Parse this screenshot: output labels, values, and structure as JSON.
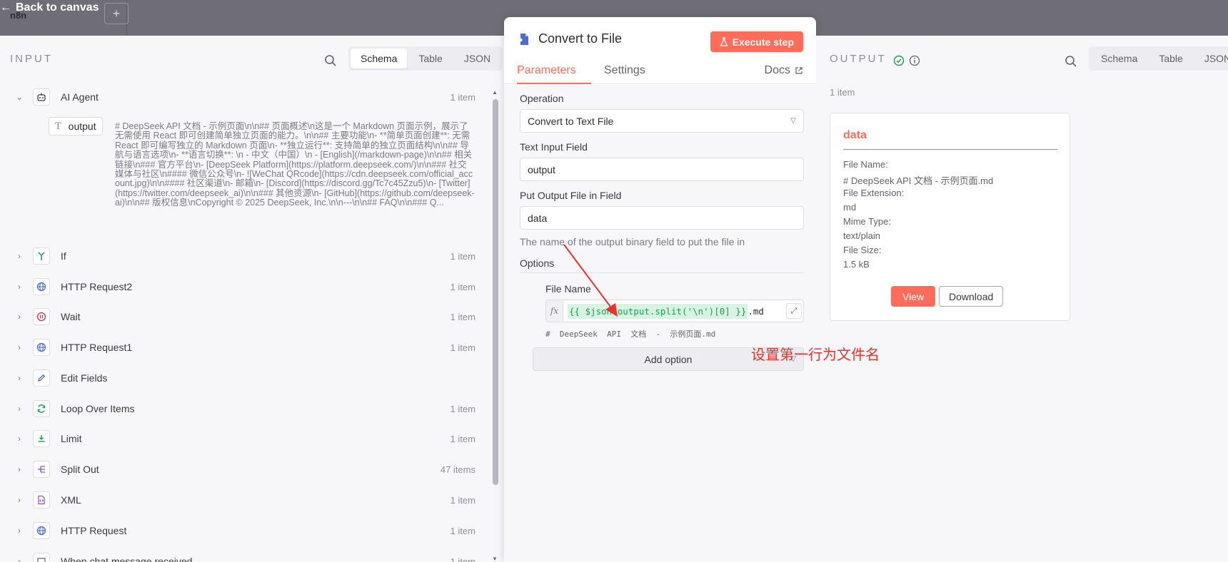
{
  "topbar": {
    "back_label": "Back to canvas",
    "canvas_label": "n8n",
    "add_label": "+"
  },
  "input_panel": {
    "title": "INPUT",
    "views": [
      "Schema",
      "Table",
      "JSON"
    ],
    "active_view": "Schema",
    "ai_agent": {
      "name": "AI Agent",
      "count": "1 item"
    },
    "output_field": {
      "name": "output",
      "type_icon": "T"
    },
    "output_value": "# DeepSeek API 文档 - 示例页面\\n\\n## 页面概述\\n这是一个 Markdown 页面示例，展示了无需使用 React 即可创建简单独立页面的能力。\\n\\n## 主要功能\\n- **简单页面创建**: 无需 React 即可编写独立的 Markdown 页面\\n- **独立运行**: 支持简单的独立页面结构\\n\\n## 导航与语言选项\\n- **语言切换**: \\n - 中文（中国）\\n - [English](/markdown-page)\\n\\n## 相关链接\\n### 官方平台\\n- [DeepSeek Platform](https://platform.deepseek.com/)\\n\\n### 社交媒体与社区\\n#### 微信公众号\\n- ![WeChat QRcode](https://cdn.deepseek.com/official_account.jpg)\\n\\n#### 社区渠道\\n- 邮箱\\n- [Discord](https://discord.gg/Tc7c45Zzu5)\\n- [Twitter](https://twitter.com/deepseek_ai)\\n\\n### 其他资源\\n- [GitHub](https://github.com/deepseek-ai)\\n\\n## 版权信息\\nCopyright © 2025 DeepSeek, Inc.\\n\\n---\\n\\n## FAQ\\n\\n### Q...",
    "nodes": [
      {
        "name": "If",
        "count": "1 item",
        "icon": "if-icon",
        "color": "#1e9a57"
      },
      {
        "name": "HTTP Request2",
        "count": "1 item",
        "icon": "globe-icon",
        "color": "#4a6fd1"
      },
      {
        "name": "Wait",
        "count": "1 item",
        "icon": "pause-icon",
        "color": "#c0364a"
      },
      {
        "name": "HTTP Request1",
        "count": "1 item",
        "icon": "globe-icon",
        "color": "#4a6fd1"
      },
      {
        "name": "Edit Fields",
        "count": "",
        "icon": "pencil-icon",
        "color": "#4a6fd1"
      },
      {
        "name": "Loop Over Items",
        "count": "1 item",
        "icon": "loop-icon",
        "color": "#1e9a57"
      },
      {
        "name": "Limit",
        "count": "1 item",
        "icon": "limit-icon",
        "color": "#1e9a57"
      },
      {
        "name": "Split Out",
        "count": "47 items",
        "icon": "split-icon",
        "color": "#8a4fd1"
      },
      {
        "name": "XML",
        "count": "1 item",
        "icon": "file-code-icon",
        "color": "#8a4fd1"
      },
      {
        "name": "HTTP Request",
        "count": "1 item",
        "icon": "globe-icon",
        "color": "#4a6fd1"
      },
      {
        "name": "When chat message received",
        "count": "1 item",
        "icon": "chat-icon",
        "color": "#62616b"
      }
    ]
  },
  "dialog": {
    "title": "Convert to File",
    "execute_label": "Execute step",
    "tabs": [
      "Parameters",
      "Settings"
    ],
    "active_tab": "Parameters",
    "docs_label": "Docs",
    "operation_label": "Operation",
    "operation_value": "Convert to Text File",
    "text_input_label": "Text Input Field",
    "text_input_value": "output",
    "put_output_label": "Put Output File in Field",
    "put_output_value": "data",
    "put_output_hint": "The name of the output binary field to put the file in",
    "options_label": "Options",
    "file_name_label": "File Name",
    "file_name_expr_highlight": "{{ $json.output.split('\\n')[0] }}",
    "file_name_expr_suffix": ".md",
    "file_name_preview": "#  DeepSeek  API  文档  -  示例页面.md",
    "add_option_label": "Add option"
  },
  "output_panel": {
    "title": "OUTPUT",
    "views": [
      "Schema",
      "Table",
      "JSON"
    ],
    "count": "1 item",
    "card": {
      "title": "data",
      "file_name_key": "File Name:",
      "file_name_value": "# DeepSeek API 文档 - 示例页面.md",
      "ext_key": "File Extension:",
      "ext_value": "md",
      "mime_key": "Mime Type:",
      "mime_value": "text/plain",
      "size_key": "File Size:",
      "size_value": "1.5 kB",
      "view_label": "View",
      "download_label": "Download"
    }
  },
  "annotation": {
    "text": "设置第一行为文件名",
    "color": "#e8332a"
  },
  "colors": {
    "accent": "#ff6d5a",
    "success": "#1e9a57"
  }
}
